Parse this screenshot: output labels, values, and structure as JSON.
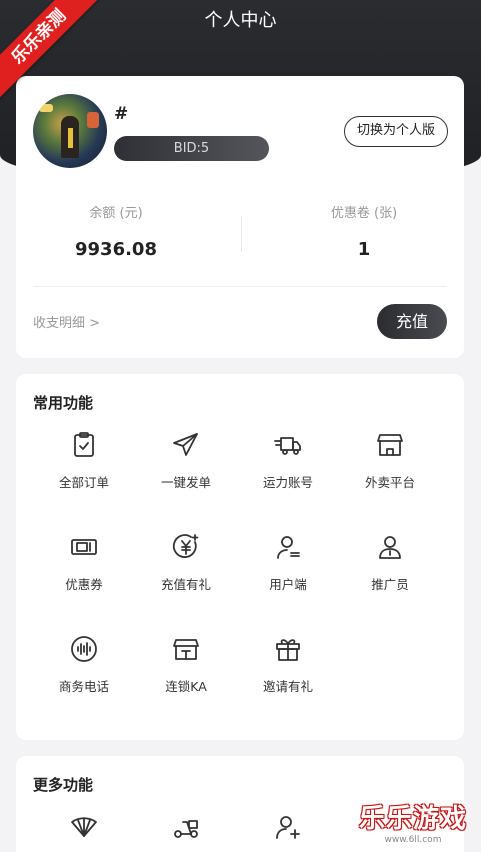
{
  "watermark_ribbon": "乐乐亲测",
  "page_title": "个人中心",
  "profile": {
    "username": "#",
    "bid": "BID:5",
    "switch_label": "切换为个人版",
    "balance_label": "余额 (元)",
    "balance_value": "9936.08",
    "coupon_label": "优惠卷 (张)",
    "coupon_value": "1",
    "detail_link": "收支明细 >",
    "recharge_label": "充值"
  },
  "common_functions": {
    "title": "常用功能",
    "items": [
      {
        "label": "全部订单",
        "icon": "clipboard-check-icon"
      },
      {
        "label": "一键发单",
        "icon": "paper-plane-icon"
      },
      {
        "label": "运力账号",
        "icon": "delivery-truck-icon"
      },
      {
        "label": "外卖平台",
        "icon": "storefront-icon"
      },
      {
        "label": "优惠券",
        "icon": "ticket-icon"
      },
      {
        "label": "充值有礼",
        "icon": "yen-coin-icon"
      },
      {
        "label": "用户端",
        "icon": "user-card-icon"
      },
      {
        "label": "推广员",
        "icon": "user-badge-icon"
      },
      {
        "label": "商务电话",
        "icon": "phone-wave-icon"
      },
      {
        "label": "连锁KA",
        "icon": "chain-store-icon"
      },
      {
        "label": "邀请有礼",
        "icon": "gift-icon"
      }
    ]
  },
  "more_functions": {
    "title": "更多功能",
    "items": [
      {
        "icon": "fan-icon"
      },
      {
        "icon": "scooter-icon"
      },
      {
        "icon": "add-user-icon"
      }
    ]
  },
  "watermark": {
    "brand": "乐乐游戏",
    "url": "www.6ll.com"
  }
}
